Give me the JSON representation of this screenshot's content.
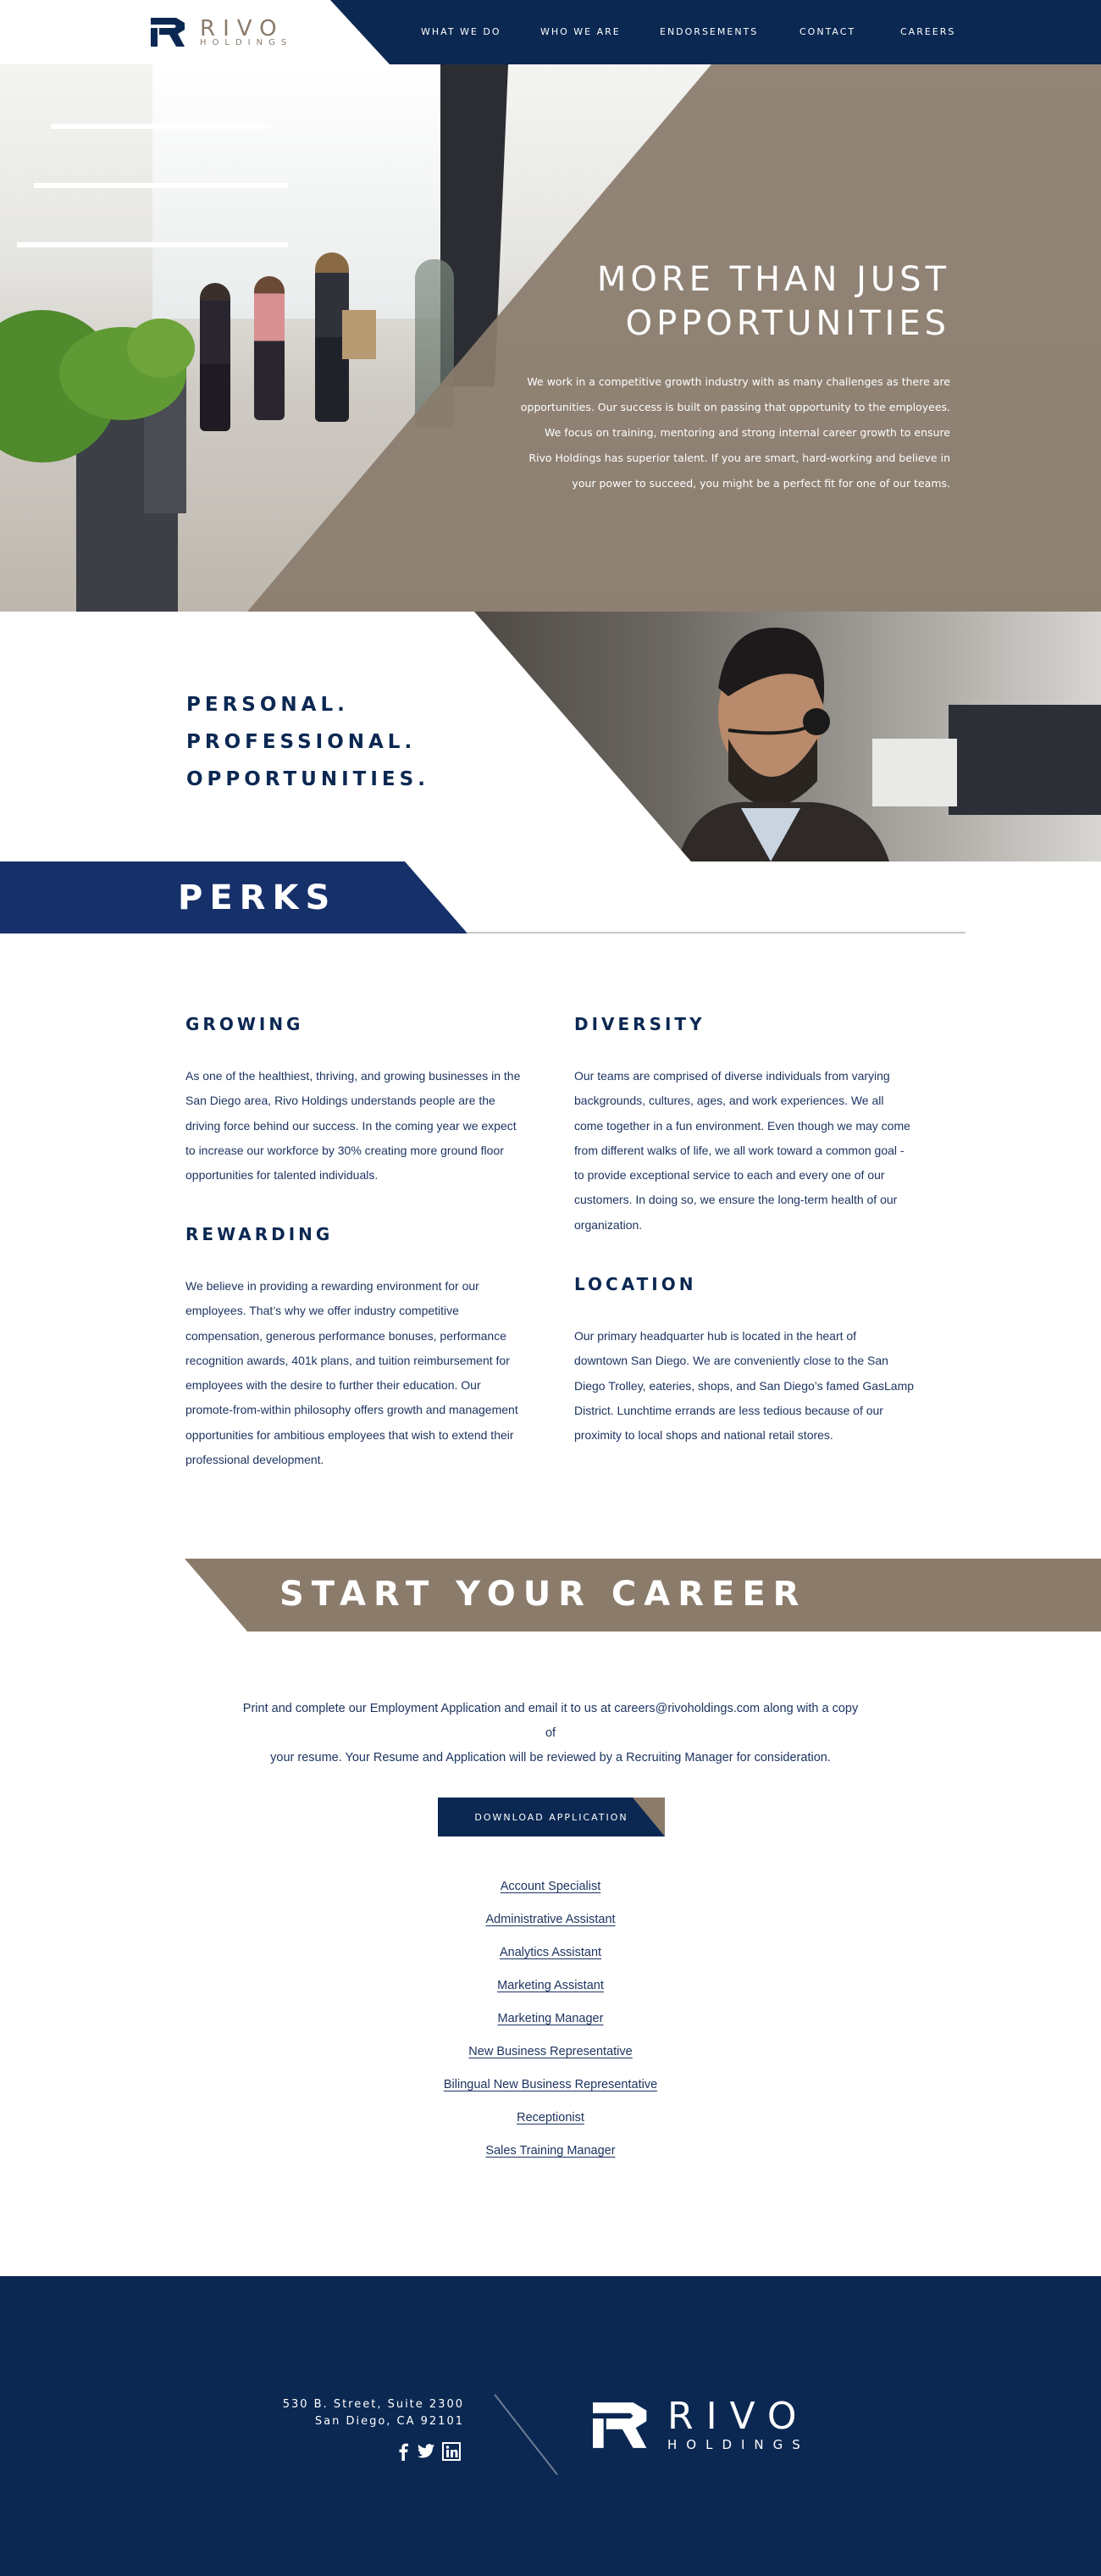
{
  "brand": {
    "name": "RIVO",
    "sub": "HOLDINGS",
    "colors": {
      "navy": "#0b2852",
      "perks_navy": "#16306a",
      "taupe": "#8b7b6b",
      "text": "#1d3461"
    }
  },
  "nav": {
    "items": [
      "WHAT WE DO",
      "WHO WE ARE",
      "ENDORSEMENTS",
      "CONTACT",
      "CAREERS"
    ]
  },
  "hero": {
    "title_line1": "MORE THAN JUST",
    "title_line2": "OPPORTUNITIES",
    "body": [
      "We work in a competitive growth industry with as many challenges as there are",
      "opportunities. Our success is built on passing that opportunity to the employees.",
      "We focus on training, mentoring and strong internal career growth to ensure",
      "Rivo Holdings has superior talent. If you are smart, hard-working and believe in",
      "your power to succeed, you might be a perfect fit for one of our teams."
    ]
  },
  "personal": {
    "lines": [
      "PERSONAL.",
      "PROFESSIONAL.",
      "OPPORTUNITIES."
    ]
  },
  "perks": {
    "title": "PERKS",
    "growing": {
      "heading": "GROWING",
      "lines": [
        "As one of the healthiest, thriving, and growing businesses in the",
        "San Diego area, Rivo Holdings understands people are the",
        "driving force behind our success. In the coming year we expect",
        "to increase our workforce by 30% creating more ground floor",
        "opportunities for talented individuals."
      ]
    },
    "rewarding": {
      "heading": "REWARDING",
      "lines": [
        "We believe in providing a rewarding environment for our",
        "employees.  That’s why we offer industry competitive",
        "compensation, generous performance bonuses, performance",
        "recognition awards, 401k plans, and tuition reimbursement for",
        "employees with the desire to further their education.  Our",
        "promote-from-within philosophy offers growth and management",
        "opportunities for ambitious employees that wish to extend their",
        "professional development."
      ]
    },
    "diversity": {
      "heading": "DIVERSITY",
      "lines": [
        "Our teams are comprised of diverse individuals from varying",
        "backgrounds, cultures, ages, and work experiences.  We all",
        "come together in a fun environment. Even though we may come",
        "from different walks of life, we all work toward a common goal -",
        "to provide exceptional service to each and every one of our",
        "customers.  In doing so, we ensure the long-term health of our",
        "organization."
      ]
    },
    "location": {
      "heading": "LOCATION",
      "lines": [
        "Our primary headquarter hub is located in the heart of",
        "downtown San Diego. We are conveniently close to the San",
        "Diego Trolley, eateries, shops, and San Diego’s famed GasLamp",
        "District.  Lunchtime errands are less tedious because of our",
        "proximity to local shops and national retail stores."
      ]
    }
  },
  "career": {
    "title": "START YOUR CAREER",
    "text_line1": "Print and complete our Employment Application and email it to us at careers@rivoholdings.com along with a copy of",
    "text_line2": "your resume. Your Resume and Application will be reviewed by a Recruiting Manager for consideration.",
    "button": "DOWNLOAD APPLICATION",
    "jobs": [
      "Account Specialist",
      "Administrative Assistant",
      "Analytics Assistant",
      "Marketing Assistant",
      "Marketing Manager",
      "New Business Representative",
      "Bilingual New Business Representative",
      "Receptionist",
      "Sales Training Manager"
    ]
  },
  "footer": {
    "address_line1": "530 B. Street, Suite 2300",
    "address_line2": "San Diego, CA 92101",
    "social": [
      "facebook-icon",
      "twitter-icon",
      "linkedin-icon"
    ]
  }
}
